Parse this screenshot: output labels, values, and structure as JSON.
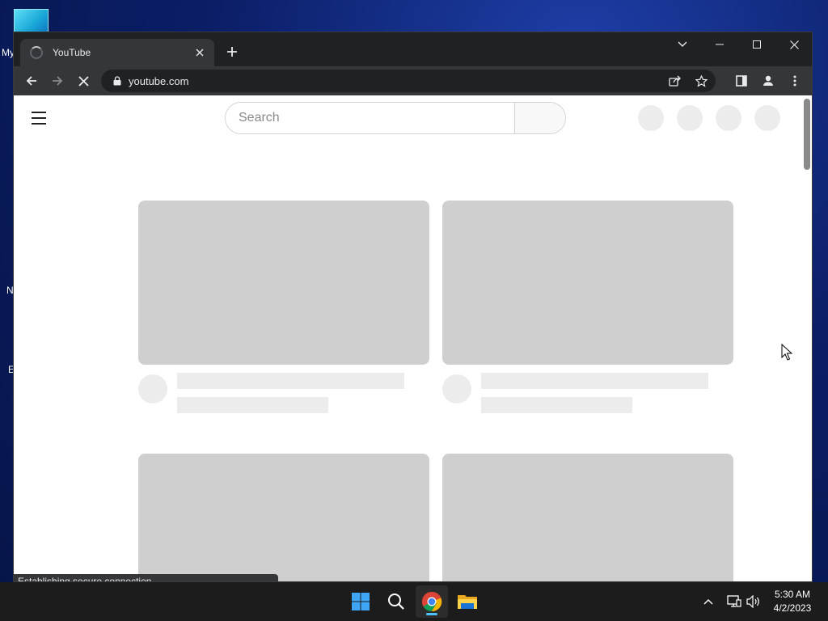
{
  "desktop": {
    "fragments": [
      "My",
      "N",
      "E"
    ]
  },
  "browser": {
    "tab": {
      "title": "YouTube"
    },
    "address_bar": {
      "url": "youtube.com"
    },
    "status_bubble": "Establishing secure connection..."
  },
  "page": {
    "search": {
      "placeholder": "Search"
    }
  },
  "taskbar": {
    "time": "5:30 AM",
    "date": "4/2/2023"
  },
  "icons": {
    "tab_loading": "spinner-icon",
    "tab_close": "close-icon",
    "new_tab": "plus-icon",
    "tab_search": "chevron-down-icon",
    "back": "arrow-left-icon",
    "forward": "arrow-right-icon",
    "stop": "close-icon",
    "lock": "lock-icon",
    "share": "share-icon",
    "bookmark": "star-icon",
    "side_panel": "side-panel-icon",
    "profile": "profile-icon",
    "menu": "kebab-menu-icon",
    "hamburger": "hamburger-icon",
    "start": "windows-logo-icon",
    "search_taskbar": "search-icon",
    "chrome": "chrome-icon",
    "explorer": "folder-icon",
    "tray_chevron": "chevron-up-icon",
    "network": "network-icon",
    "volume": "volume-icon"
  },
  "colors": {
    "desktop_bg": "#0b1e66",
    "chrome_dark": "#202124",
    "chrome_toolbar": "#35363a",
    "skeleton_thumb": "#cfcfcf",
    "skeleton_light": "#ececec",
    "taskbar_bg": "#1c1c1c",
    "active_indicator": "#4cc2ff"
  }
}
